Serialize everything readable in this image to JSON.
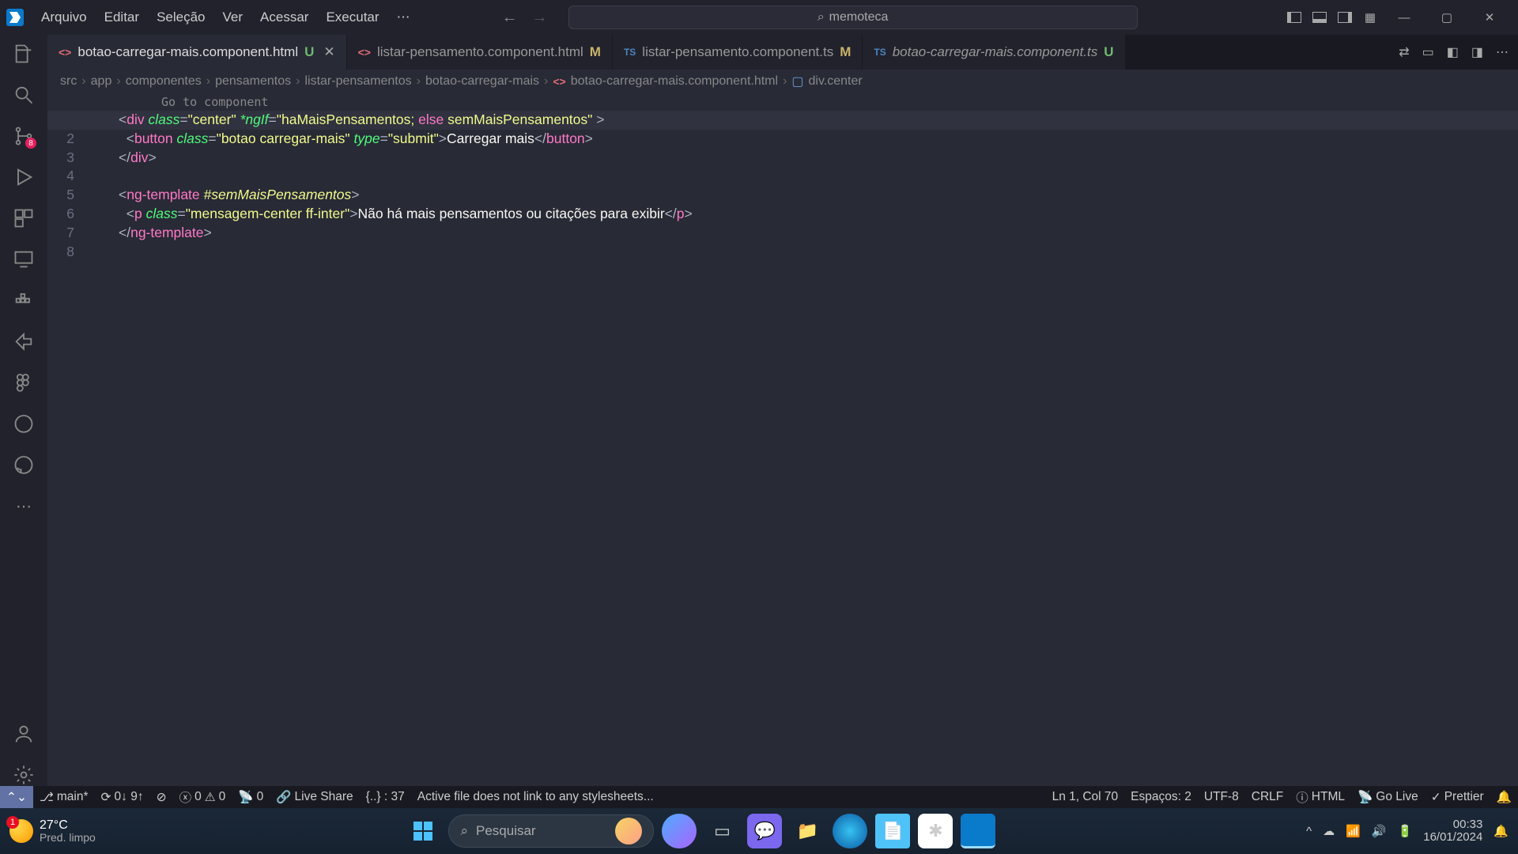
{
  "menu": [
    "Arquivo",
    "Editar",
    "Seleção",
    "Ver",
    "Acessar",
    "Executar"
  ],
  "search_text": "memoteca",
  "tabs": [
    {
      "icon": "<>",
      "icontype": "html",
      "name": "botao-carregar-mais.component.html",
      "status": "U",
      "active": true,
      "close": true,
      "italic": false
    },
    {
      "icon": "<>",
      "icontype": "html",
      "name": "listar-pensamento.component.html",
      "status": "M",
      "active": false,
      "close": false,
      "italic": false
    },
    {
      "icon": "TS",
      "icontype": "ts",
      "name": "listar-pensamento.component.ts",
      "status": "M",
      "active": false,
      "close": false,
      "italic": false
    },
    {
      "icon": "TS",
      "icontype": "ts",
      "name": "botao-carregar-mais.component.ts",
      "status": "U",
      "active": false,
      "close": false,
      "italic": true
    }
  ],
  "breadcrumbs": [
    "src",
    "app",
    "componentes",
    "pensamentos",
    "listar-pensamentos",
    "botao-carregar-mais"
  ],
  "breadcrumb_file": "botao-carregar-mais.component.html",
  "breadcrumb_symbol": "div.center",
  "hint": "Go to component",
  "line_count": 8,
  "statusbar": {
    "branch": "main*",
    "sync": "0↓ 9↑",
    "errors": "0",
    "warnings": "0",
    "ports": "0",
    "liveshare": "Live Share",
    "bracket": "{..} : 37",
    "stylesheet": "Active file does not link to any stylesheets...",
    "position": "Ln 1, Col 70",
    "spaces": "Espaços: 2",
    "encoding": "UTF-8",
    "eol": "CRLF",
    "lang": "HTML",
    "golive": "Go Live",
    "prettier": "Prettier"
  },
  "taskbar": {
    "temp": "27°C",
    "cond": "Pred. limpo",
    "search_placeholder": "Pesquisar",
    "time": "00:33",
    "date": "16/01/2024"
  },
  "code": {
    "l1": {
      "tag_div": "div",
      "class_attr": "class",
      "class_val": "\"center\"",
      "ngif": "*ngIf",
      "ngif_val_a": "\"haMaisPensamentos;",
      "else": "else",
      "ngif_val_b": "semMaisPensamentos\""
    },
    "l2": {
      "tag_btn": "button",
      "class_attr": "class",
      "class_val": "\"botao carregar-mais\"",
      "type_attr": "type",
      "type_val": "\"submit\"",
      "text": "Carregar mais"
    },
    "l3": {
      "tag_div": "div"
    },
    "l5": {
      "tag_tpl": "ng-template",
      "ref": "#semMaisPensamentos"
    },
    "l6": {
      "tag_p": "p",
      "class_attr": "class",
      "class_val": "\"mensagem-center ff-inter\"",
      "text": "Não há mais pensamentos ou citações para exibir"
    },
    "l7": {
      "tag_tpl": "ng-template"
    }
  }
}
